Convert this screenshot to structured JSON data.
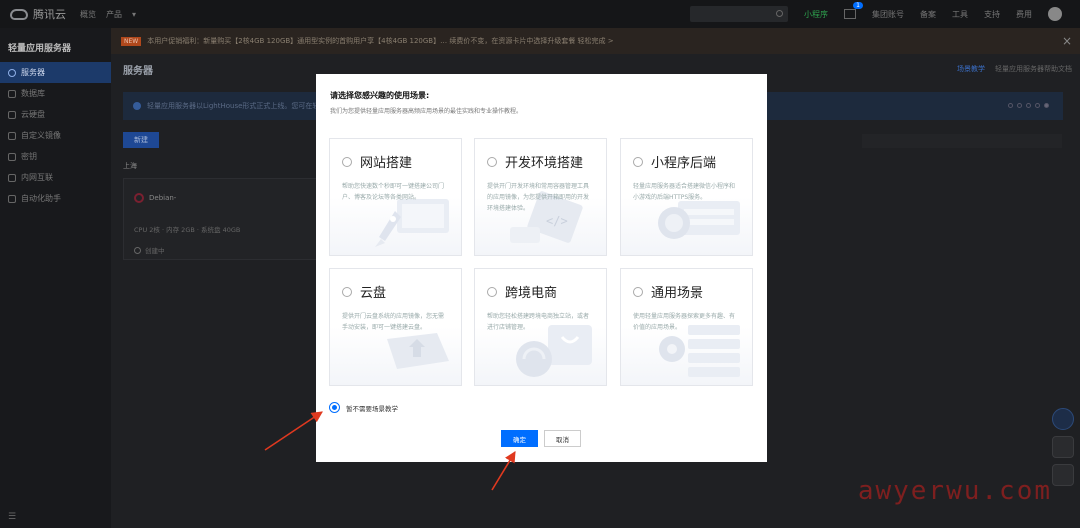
{
  "topbar": {
    "brand": "腾讯云",
    "nav": [
      "概览",
      "产品"
    ],
    "links": [
      "小程序",
      "集团账号",
      "备案",
      "工具",
      "支持",
      "费用"
    ],
    "message_count": "1"
  },
  "sidebar": {
    "title": "轻量应用服务器",
    "items": [
      {
        "label": "服务器",
        "active": true
      },
      {
        "label": "数据库",
        "active": false
      },
      {
        "label": "云硬盘",
        "active": false
      },
      {
        "label": "自定义镜像",
        "active": false
      },
      {
        "label": "密钥",
        "active": false
      },
      {
        "label": "内网互联",
        "active": false
      },
      {
        "label": "自动化助手",
        "active": false
      }
    ],
    "footer": "☰"
  },
  "main": {
    "announcement_tag": "NEW",
    "announcement": "本用户促销福利：新量购买【2核4GB 120GB】通用型实例的首购用户享【4核4GB 120GB】… 续费价不变，在资源卡片中选择升级套餐 轻松完成 >",
    "page_title": "服务器",
    "help_links": [
      "场景教学",
      "轻量应用服务器帮助文档"
    ],
    "info_text": "轻量应用服务器以LightHouse形式正式上线。您可在轻量…",
    "new_button": "新建",
    "region": "上海",
    "instance": {
      "os": "Debian-",
      "spec": "CPU 2核 · 内存 2GB · 系统盘 40GB",
      "status": "创建中"
    },
    "watermark": "awyerwu.com"
  },
  "modal": {
    "title": "请选择您感兴趣的使用场景:",
    "subtitle": "我们为您提供轻量应用服务器高频应用场景的最佳实践和专业操作教程。",
    "options": [
      {
        "title": "网站搭建",
        "desc": "帮助您快速数个秒即可一键搭建公司门户、博客及论坛等各类网站。"
      },
      {
        "title": "开发环境搭建",
        "desc": "提供开门开发环境和常用容器管理工具的应用镜像，为您提供开箱即用的开发环境搭建体验。"
      },
      {
        "title": "小程序后端",
        "desc": "轻量应用服务器适合搭建微信小程序和小游戏的后端HTTPS服务。"
      },
      {
        "title": "云盘",
        "desc": "提供开门云盘系统的应用镜像，您无需手动安装，即可一键搭建云盘。"
      },
      {
        "title": "跨境电商",
        "desc": "帮助您轻松搭建跨境电商独立站，或者进行店铺管理。"
      },
      {
        "title": "通用场景",
        "desc": "使用轻量应用服务器探索更多有趣、有价值的应用场景。"
      }
    ],
    "no_need_label": "暂不需要场景教学",
    "confirm_label": "确定",
    "cancel_label": "取消"
  },
  "colors": {
    "accent": "#006eff",
    "annotation_arrow": "#e0391f",
    "watermark": "#7e1f1f"
  }
}
